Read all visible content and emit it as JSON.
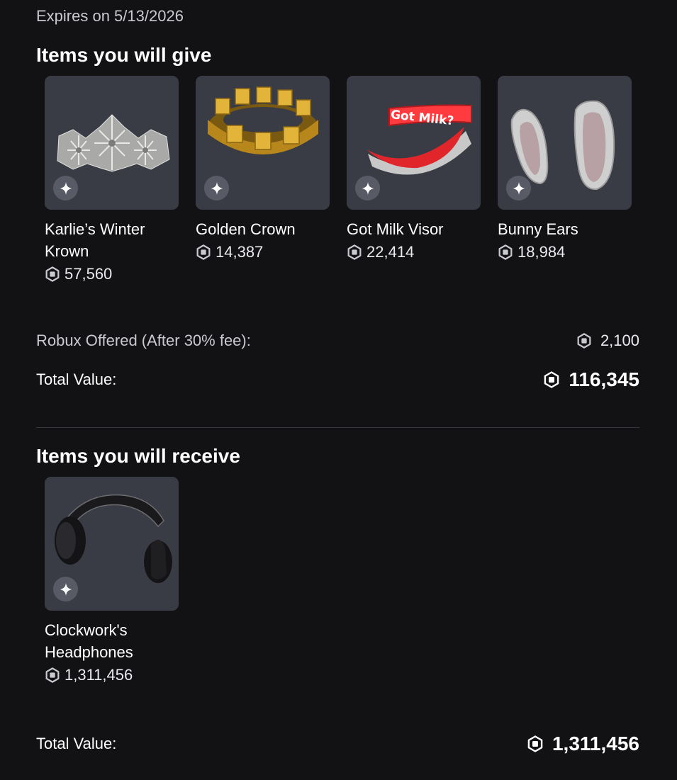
{
  "expires_text": "Expires on 5/13/2026",
  "give": {
    "title": "Items you will give",
    "items": [
      {
        "name": "Karlie’s Winter Krown",
        "price": "57,560",
        "art": "winter-krown"
      },
      {
        "name": "Golden Crown",
        "price": "14,387",
        "art": "golden-crown"
      },
      {
        "name": "Got Milk Visor",
        "price": "22,414",
        "art": "got-milk-visor",
        "visor_text": "Got Milk?"
      },
      {
        "name": "Bunny Ears",
        "price": "18,984",
        "art": "bunny-ears"
      }
    ],
    "robux_offered_label": "Robux Offered (After 30% fee):",
    "robux_offered_value": "2,100",
    "total_label": "Total Value:",
    "total_value": "116,345"
  },
  "receive": {
    "title": "Items you will receive",
    "items": [
      {
        "name": "Clockwork's Headphones",
        "price": "1,311,456",
        "art": "headphones"
      }
    ],
    "total_label": "Total Value:",
    "total_value": "1,311,456"
  },
  "icons": {
    "currency": "robux-icon",
    "badge": "sparkle-icon"
  },
  "colors": {
    "background": "#121215",
    "card": "#3a3c45",
    "badge": "#585b66",
    "text": "#ffffff",
    "muted": "#c9cacf"
  }
}
